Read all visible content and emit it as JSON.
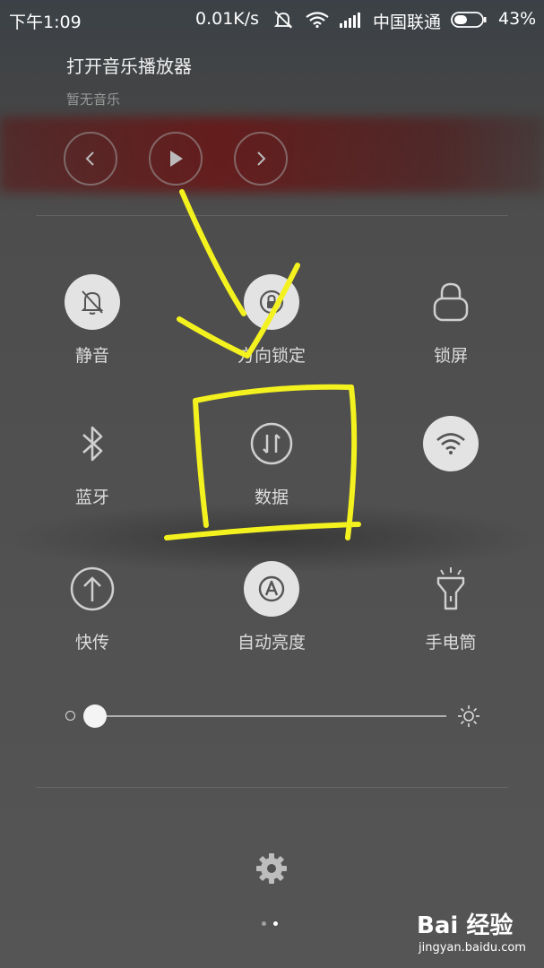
{
  "status_bar": {
    "time": "下午1:09",
    "net_speed": "0.01K/s",
    "carrier": "中国联通",
    "battery_percent": "43%",
    "battery_level": 0.43,
    "icons": [
      "mute-vibrate-icon",
      "wifi-icon",
      "signal-icon",
      "battery-icon"
    ]
  },
  "music": {
    "title": "打开音乐播放器",
    "subtitle": "暂无音乐",
    "controls": [
      "previous-icon",
      "play-icon",
      "next-icon"
    ]
  },
  "toggles": [
    {
      "label": "静音",
      "icon": "mute-icon",
      "on": true
    },
    {
      "label": "方向锁定",
      "icon": "rotation-lock-icon",
      "on": true
    },
    {
      "label": "锁屏",
      "icon": "lock-icon",
      "on": false
    },
    {
      "label": "蓝牙",
      "icon": "bluetooth-icon",
      "on": false
    },
    {
      "label": "数据",
      "icon": "mobile-data-icon",
      "on": false
    },
    {
      "label": "WLAN",
      "icon": "wifi-icon",
      "on": true
    },
    {
      "label": "快传",
      "icon": "quick-transfer-icon",
      "on": false
    },
    {
      "label": "自动亮度",
      "icon": "auto-brightness-icon",
      "on": true
    },
    {
      "label": "手电筒",
      "icon": "flashlight-icon",
      "on": false
    }
  ],
  "brightness": {
    "level": 0.0,
    "min_icon": "brightness-low-icon",
    "max_icon": "brightness-high-icon"
  },
  "settings_icon": "gear-icon",
  "page_indicator": {
    "count": 2,
    "active": 1
  },
  "watermark": {
    "brand": "Bai 经验",
    "url": "jingyan.baidu.com"
  },
  "colors": {
    "annotation": "#f4f21e",
    "toggle_on": "#e3e3e3"
  }
}
